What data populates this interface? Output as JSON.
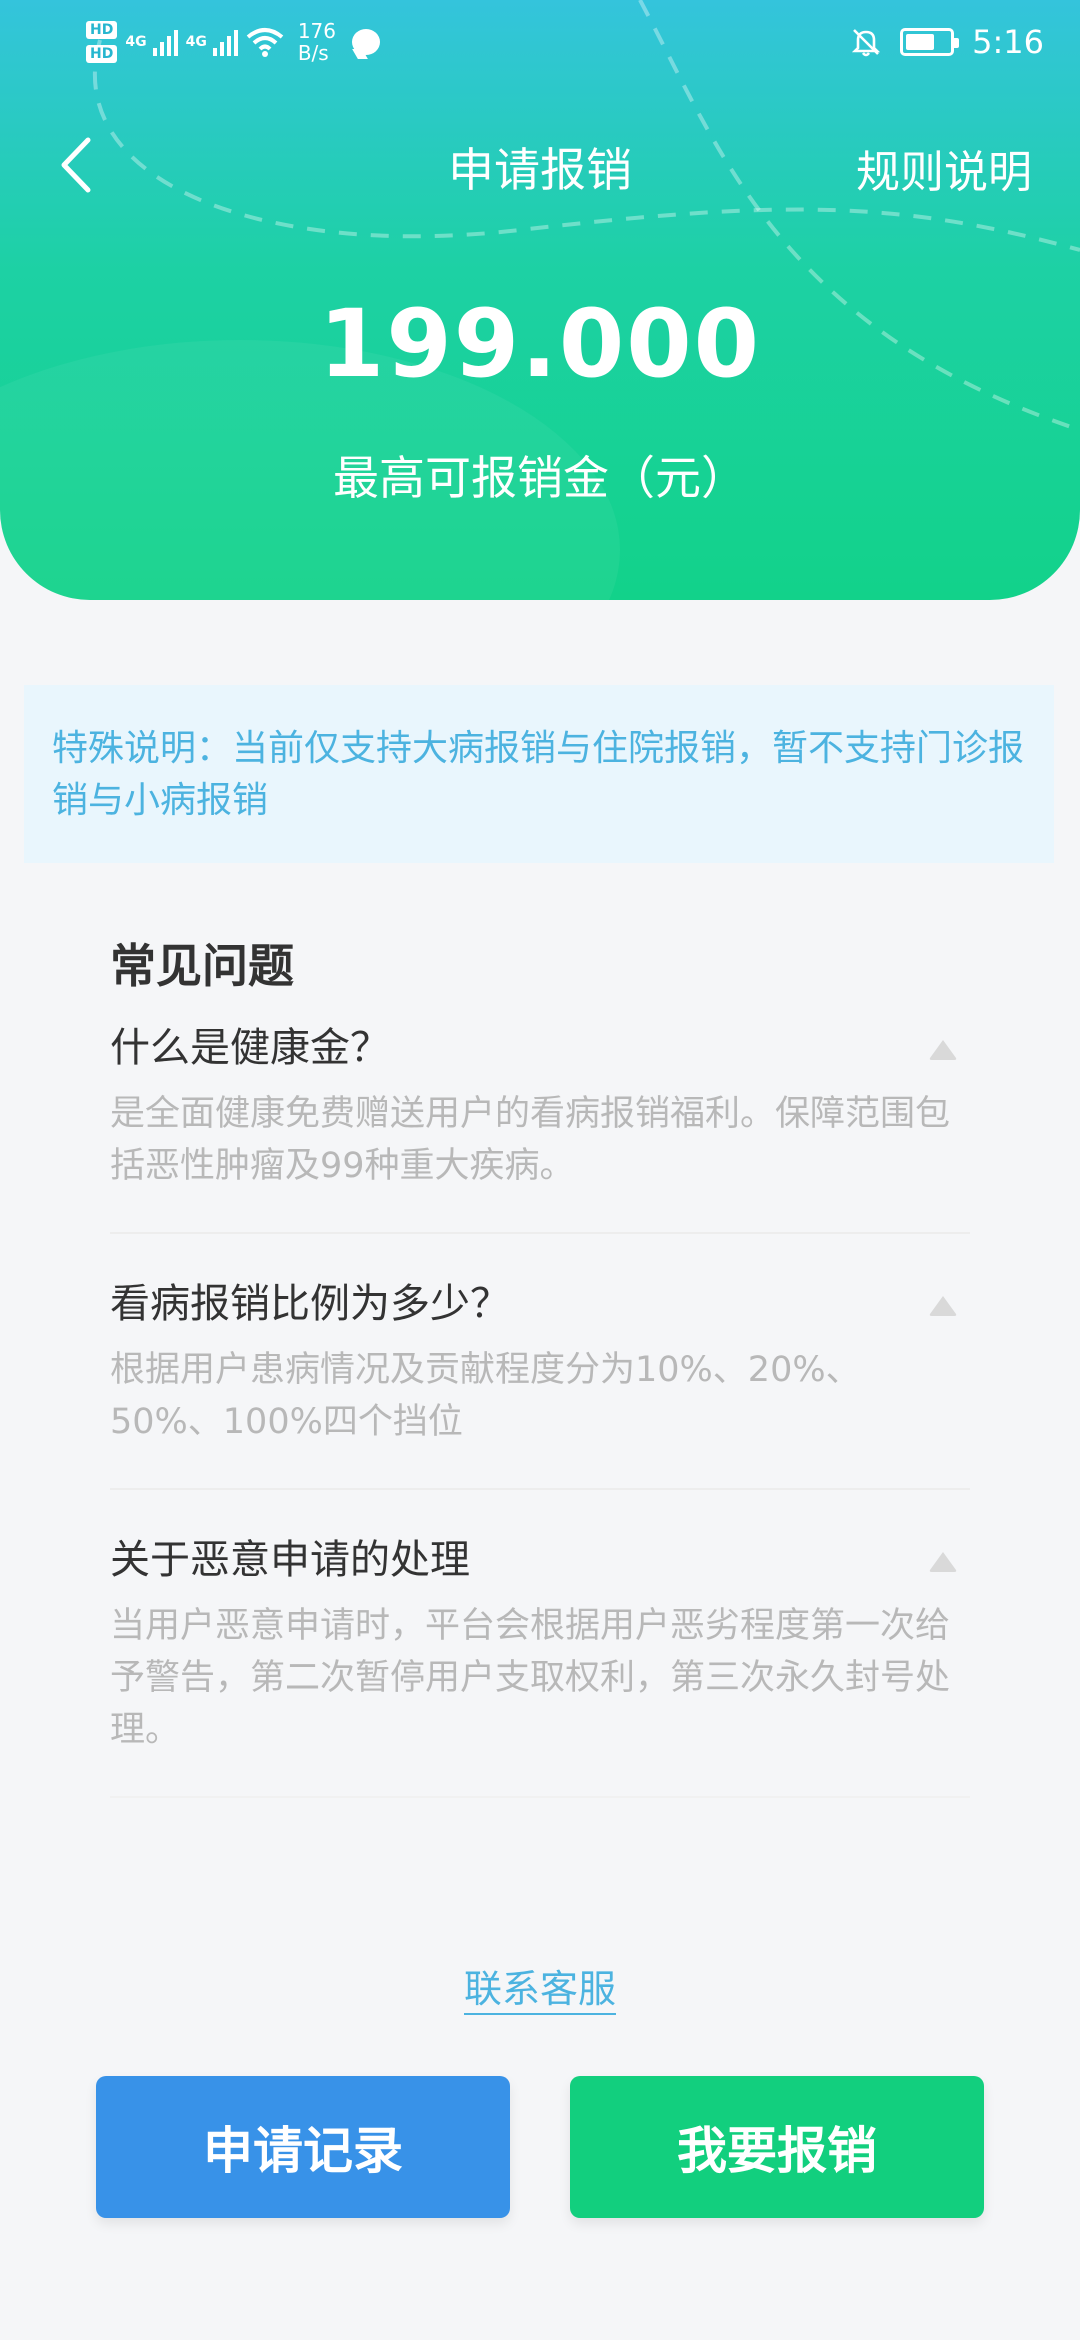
{
  "status_bar": {
    "hd1": "HD",
    "hd2": "HD",
    "net1": "4G",
    "net2": "4G",
    "speed_value": "176",
    "speed_unit": "B/s",
    "time": "5:16"
  },
  "header": {
    "title": "申请报销",
    "rules_label": "规则说明",
    "amount": "199.000",
    "amount_label": "最高可报销金（元）"
  },
  "notice": {
    "text": "特殊说明：当前仅支持大病报销与住院报销，暂不支持门诊报销与小病报销"
  },
  "faq": {
    "title": "常见问题",
    "items": [
      {
        "question": "什么是健康金？",
        "answer": "是全面健康免费赠送用户的看病报销福利。保障范围包括恶性肿瘤及99种重大疾病。"
      },
      {
        "question": "看病报销比例为多少？",
        "answer": "根据用户患病情况及贡献程度分为10%、20%、50%、100%四个挡位"
      },
      {
        "question": "关于恶意申请的处理",
        "answer": "当用户恶意申请时，平台会根据用户恶劣程度第一次给予警告，第二次暂停用户支取权利，第三次永久封号处理。"
      }
    ]
  },
  "contact_label": "联系客服",
  "buttons": {
    "record_label": "申请记录",
    "apply_label": "我要报销"
  },
  "colors": {
    "primary_green": "#12cf7e",
    "primary_blue": "#3892e8",
    "notice_text": "#4cb3e0",
    "notice_bg": "#e9f6fd"
  }
}
